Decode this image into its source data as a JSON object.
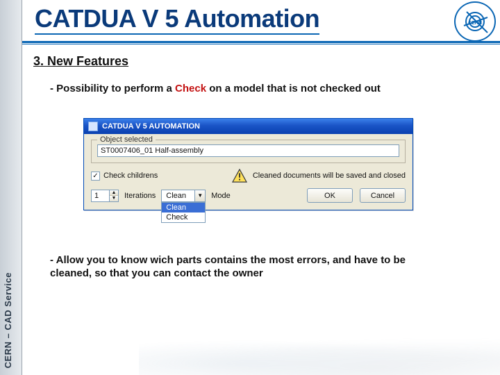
{
  "sidebar": {
    "label": "CERN – CAD Service"
  },
  "header": {
    "title": "CATDUA V 5 Automation",
    "logo_text": "CERN"
  },
  "section": {
    "title": "3. New Features",
    "bullet_a_prefix": "- Possibility to perform a ",
    "bullet_a_check": "Check",
    "bullet_a_suffix": " on a model that is not checked out",
    "bullet_b": "- Allow you to know wich parts contains the most errors, and have to be cleaned, so that you can contact the owner"
  },
  "dialog": {
    "title": "CATDUA V 5 AUTOMATION",
    "grp_legend": "Object selected",
    "object_value": "ST0007406_01 Half-assembly",
    "check_children_label": "Check childrens",
    "check_children_checked": "✓",
    "warn_text": "Cleaned documents will be saved and closed",
    "iterations_value": "1",
    "iterations_label": "Iterations",
    "mode_value": "Clean",
    "mode_label": "Mode",
    "mode_options": {
      "clean": "Clean",
      "check": "Check"
    },
    "ok": "OK",
    "cancel": "Cancel"
  }
}
